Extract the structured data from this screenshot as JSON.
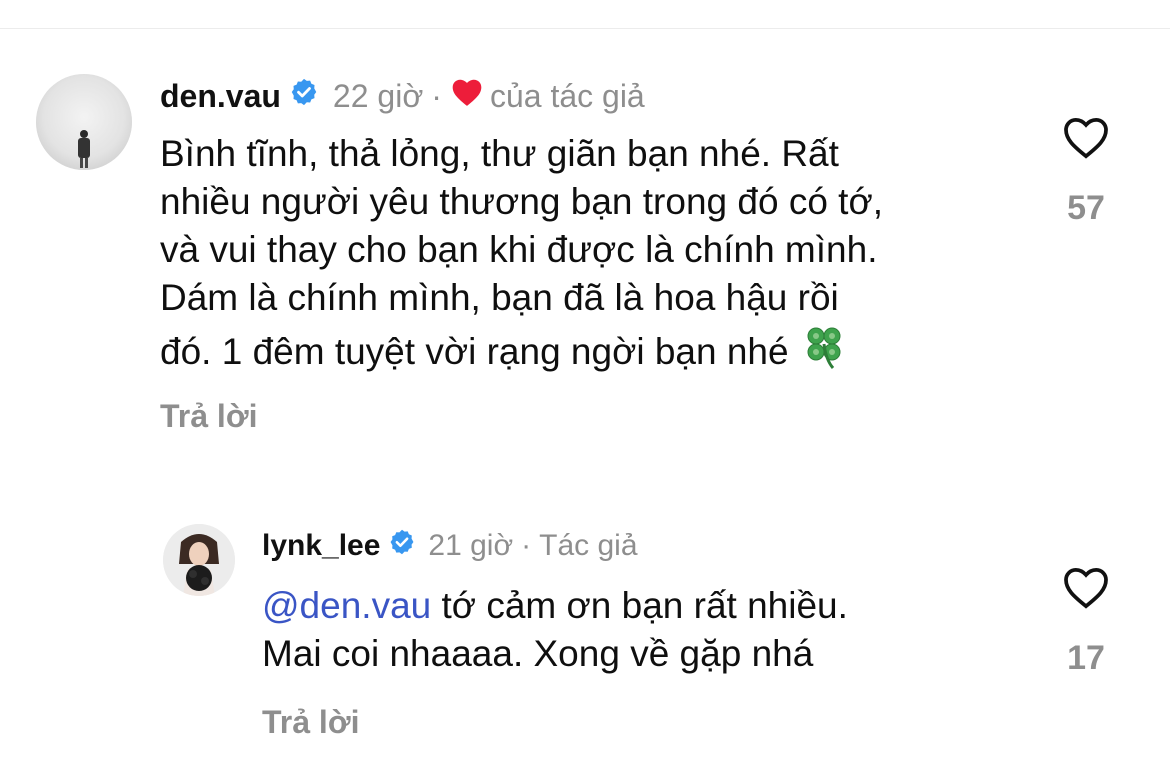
{
  "colors": {
    "text": "#0f0f0f",
    "muted": "#8e8e8e",
    "mention": "#3a55c5",
    "verified": "#3897f0",
    "heart": "#ed1d3a"
  },
  "comments": [
    {
      "username": "den.vau",
      "verified": true,
      "time": "22 giờ",
      "separator": "·",
      "liked_by_author_label": "của tác giả",
      "lines": [
        "Bình tĩnh, thả lỏng, thư giãn bạn nhé. Rất",
        "nhiều người yêu thương bạn trong đó có tớ,",
        "và vui thay cho bạn khi được là chính mình.",
        "Dám là chính mình, bạn đã là hoa hậu rồi",
        "đó. 1 đêm tuyệt vời rạng ngời bạn nhé"
      ],
      "trailing_icon": "four-leaf-clover-emoji",
      "reply_label": "Trả lời",
      "like_count": "57"
    },
    {
      "username": "lynk_lee",
      "verified": true,
      "time": "21 giờ",
      "separator": "·",
      "author_label": "Tác giả",
      "mention": "@den.vau",
      "first_line_rest": " tớ cảm ơn bạn rất nhiều.",
      "second_line": "Mai coi nhaaaa. Xong về gặp nhá",
      "reply_label": "Trả lời",
      "like_count": "17"
    }
  ],
  "icons": {
    "like": "heart-outline-icon",
    "verified": "verified-badge-icon",
    "author_like": "heart-filled-icon"
  }
}
